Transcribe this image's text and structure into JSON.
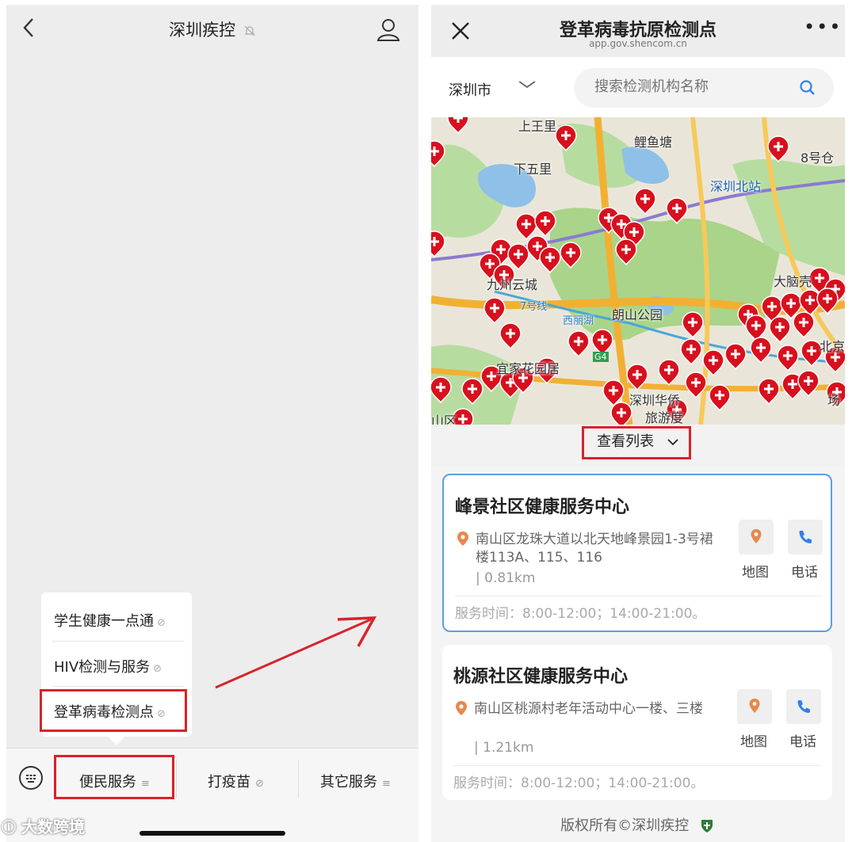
{
  "left": {
    "header": {
      "title": "深圳疾控",
      "mute_icon": "bell-slash-icon"
    },
    "menu": [
      {
        "label": "学生健康一点通",
        "icon": "link-icon"
      },
      {
        "label": "HIV检测与服务",
        "icon": "link-icon"
      },
      {
        "label": "登革病毒检测点",
        "icon": "link-icon"
      }
    ],
    "tabs": [
      {
        "label": "便民服务",
        "icon": "menu-icon"
      },
      {
        "label": "打疫苗",
        "icon": "link-icon"
      },
      {
        "label": "其它服务",
        "icon": "menu-icon"
      }
    ],
    "watermark": "大数跨境",
    "highlight_color": "#d8232a"
  },
  "right": {
    "header": {
      "title": "登革病毒抗原检测点",
      "subtitle": "app.gov.shencom.cn",
      "more": "•••"
    },
    "search": {
      "city": "深圳市",
      "placeholder": "搜索检测机构名称"
    },
    "map": {
      "labels": [
        "上王里",
        "鲤鱼塘",
        "8号仓",
        "下五里",
        "深圳北站",
        "大脑壳",
        "九州云城",
        "7号线",
        "西丽湖",
        "朗山公园",
        "G4",
        "宜家花园居",
        "深圳华侨",
        "旅游度",
        "北京",
        "山区",
        "场"
      ]
    },
    "list_toggle": "查看列表",
    "cards": [
      {
        "name": "峰景社区健康服务中心",
        "address": "南山区龙珠大道以北天地峰景园1-3号裙楼113A、115、116",
        "distance": "| 0.81km",
        "map_label": "地图",
        "phone_label": "电话",
        "hours": "服务时间：8:00-12:00；14:00-21:00。"
      },
      {
        "name": "桃源社区健康服务中心",
        "address": "南山区桃源村老年活动中心一楼、三楼",
        "distance": "| 1.21km",
        "map_label": "地图",
        "phone_label": "电话",
        "hours": "服务时间：8:00-12:00；14:00-21:00。"
      }
    ],
    "footer": "版权所有©深圳疾控",
    "accent_color": "#2f80ed",
    "pin_color": "#e8884b"
  }
}
